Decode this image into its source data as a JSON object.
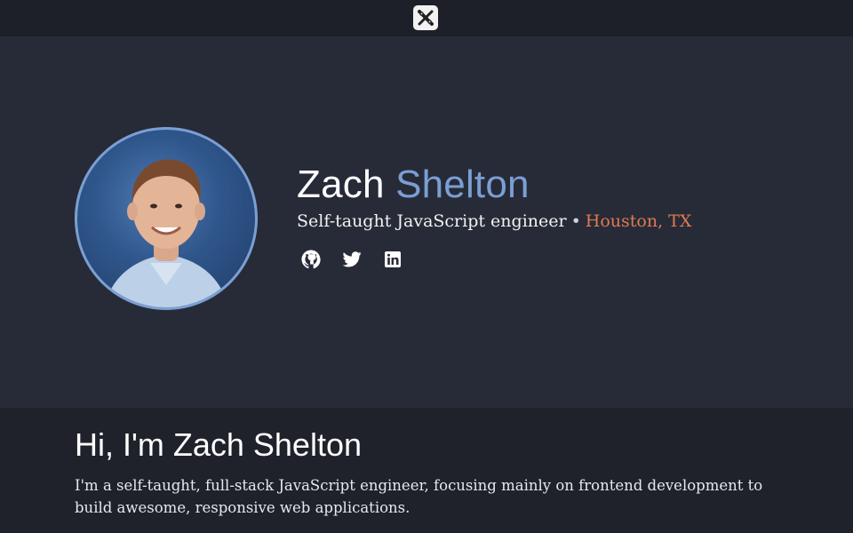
{
  "header": {
    "logo_icon": "x-logo-icon"
  },
  "hero": {
    "first_name": "Zach",
    "last_name": "Shelton",
    "role": "Self-taught JavaScript engineer",
    "separator": "•",
    "location": "Houston, TX",
    "social": [
      {
        "icon": "github-icon"
      },
      {
        "icon": "twitter-icon"
      },
      {
        "icon": "linkedin-icon"
      }
    ]
  },
  "about": {
    "heading": "Hi, I'm Zach Shelton",
    "body": "I'm a self-taught, full-stack JavaScript engineer, focusing mainly on frontend development to build awesome, responsive web applications."
  },
  "colors": {
    "accent_blue": "#7b9fd3",
    "accent_orange": "#e07a52",
    "hero_bg": "#272b38",
    "page_bg": "#1f222b"
  }
}
